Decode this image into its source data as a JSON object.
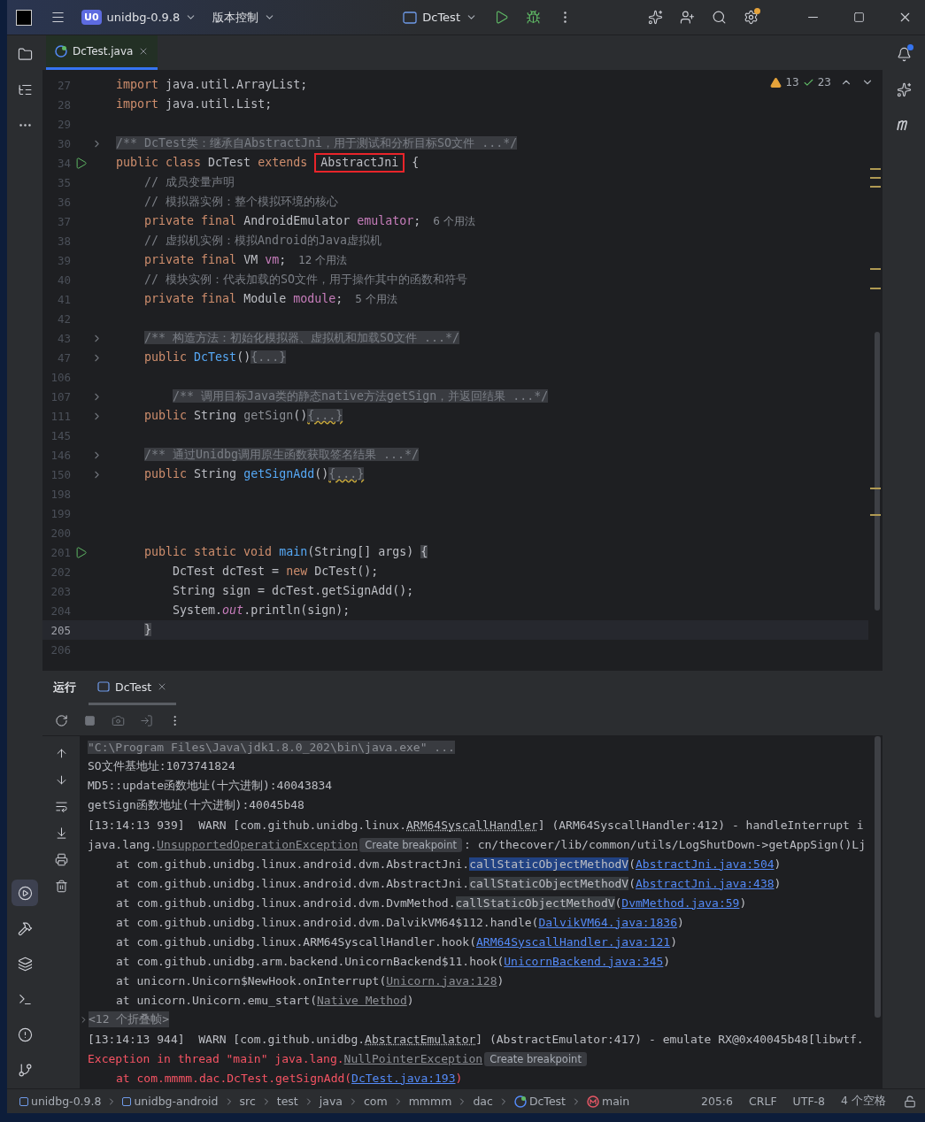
{
  "title_bar": {
    "project_badge": "U0",
    "project": "unidbg-0.9.8",
    "vcs": "版本控制",
    "run_config": "DcTest"
  },
  "editor_tabs": [
    {
      "label": "DcTest.java",
      "selected": true
    }
  ],
  "inspections": {
    "warnings": "13",
    "checks": "23"
  },
  "code_lines": [
    {
      "num": "27",
      "kind": "plain",
      "current": false,
      "tokens": [
        {
          "kind": "kw",
          "t": "import"
        },
        {
          "kind": "txt",
          "t": " java.util.ArrayList;"
        }
      ]
    },
    {
      "num": "28",
      "kind": "plain",
      "current": false,
      "tokens": [
        {
          "kind": "kw",
          "t": "import"
        },
        {
          "kind": "txt",
          "t": " java.util.List;"
        }
      ]
    },
    {
      "num": "29",
      "kind": "plain",
      "current": false
    },
    {
      "num": "30",
      "kind": "fold",
      "current": false,
      "tokens": [
        {
          "kind": "doc",
          "t": "/** DcTest类：继承自AbstractJni，用于测试和分析目标SO文件 ...*/"
        }
      ]
    },
    {
      "num": "34",
      "kind": "run",
      "current": false,
      "tokens": [
        {
          "kind": "kw",
          "t": "public class"
        },
        {
          "kind": "txt",
          "t": " DcTest "
        },
        {
          "kind": "kw",
          "t": "extends "
        },
        {
          "kind": "boxed",
          "t": "AbstractJni"
        },
        {
          "kind": "txt",
          "t": " {"
        }
      ]
    },
    {
      "num": "35",
      "kind": "plain",
      "current": false,
      "tokens": [
        {
          "kind": "cmt",
          "t": "    // 成员变量声明"
        }
      ]
    },
    {
      "num": "36",
      "kind": "plain",
      "current": false,
      "tokens": [
        {
          "kind": "cmt",
          "t": "    // 模拟器实例：整个模拟环境的核心"
        }
      ]
    },
    {
      "num": "37",
      "kind": "plain",
      "current": false,
      "hint": "6 个用法",
      "tokens": [
        {
          "kind": "kw",
          "t": "    private final"
        },
        {
          "kind": "txt",
          "t": " AndroidEmulator "
        },
        {
          "kind": "fld",
          "t": "emulator"
        },
        {
          "kind": "txt",
          "t": ";"
        }
      ]
    },
    {
      "num": "38",
      "kind": "plain",
      "current": false,
      "tokens": [
        {
          "kind": "cmt",
          "t": "    // 虚拟机实例：模拟Android的Java虚拟机"
        }
      ]
    },
    {
      "num": "39",
      "kind": "plain",
      "current": false,
      "hint": "12 个用法",
      "tokens": [
        {
          "kind": "kw",
          "t": "    private final"
        },
        {
          "kind": "txt",
          "t": " VM "
        },
        {
          "kind": "fld",
          "t": "vm"
        },
        {
          "kind": "txt",
          "t": ";"
        }
      ]
    },
    {
      "num": "40",
      "kind": "plain",
      "current": false,
      "tokens": [
        {
          "kind": "cmt",
          "t": "    // 模块实例：代表加载的SO文件，用于操作其中的函数和符号"
        }
      ]
    },
    {
      "num": "41",
      "kind": "plain",
      "current": false,
      "hint": "5 个用法",
      "tokens": [
        {
          "kind": "kw",
          "t": "    private final"
        },
        {
          "kind": "txt",
          "t": " Module "
        },
        {
          "kind": "fld",
          "t": "module"
        },
        {
          "kind": "txt",
          "t": ";"
        }
      ]
    },
    {
      "num": "42",
      "kind": "plain",
      "current": false
    },
    {
      "num": "43",
      "kind": "fold",
      "current": false,
      "tokens": [
        {
          "kind": "doc",
          "t": "    /** 构造方法：初始化模拟器、虚拟机和加载SO文件 ...*/"
        }
      ]
    },
    {
      "num": "47",
      "kind": "fold",
      "current": false,
      "tokens": [
        {
          "kind": "kw",
          "t": "    public "
        },
        {
          "kind": "fn",
          "t": "DcTest"
        },
        {
          "kind": "txt",
          "t": "()"
        },
        {
          "kind": "fold",
          "t": "{...}"
        }
      ]
    },
    {
      "num": "106",
      "kind": "plain",
      "current": false
    },
    {
      "num": "107",
      "kind": "fold",
      "current": false,
      "tokens": [
        {
          "kind": "doc",
          "t": "        /** 调用目标Java类的静态native方法getSign，并返回结果 ...*/"
        }
      ]
    },
    {
      "num": "111",
      "kind": "fold",
      "current": false,
      "tokens": [
        {
          "kind": "kw",
          "t": "    public"
        },
        {
          "kind": "txt",
          "t": " String "
        },
        {
          "kind": "dim",
          "t": "getSign"
        },
        {
          "kind": "txt",
          "t": "()"
        },
        {
          "kind": "foldw",
          "t": "{...}"
        }
      ]
    },
    {
      "num": "145",
      "kind": "plain",
      "current": false
    },
    {
      "num": "146",
      "kind": "fold",
      "current": false,
      "tokens": [
        {
          "kind": "doc",
          "t": "    /** 通过Unidbg调用原生函数获取签名结果 ...*/"
        }
      ]
    },
    {
      "num": "150",
      "kind": "fold",
      "current": false,
      "tokens": [
        {
          "kind": "kw",
          "t": "    public"
        },
        {
          "kind": "txt",
          "t": " String "
        },
        {
          "kind": "fn",
          "t": "getSignAdd"
        },
        {
          "kind": "txt",
          "t": "()"
        },
        {
          "kind": "foldw",
          "t": "{...}"
        }
      ]
    },
    {
      "num": "198",
      "kind": "plain",
      "current": false
    },
    {
      "num": "199",
      "kind": "plain",
      "current": false
    },
    {
      "num": "200",
      "kind": "plain",
      "current": false
    },
    {
      "num": "201",
      "kind": "run",
      "current": false,
      "tokens": [
        {
          "kind": "kw",
          "t": "    public static void "
        },
        {
          "kind": "fn",
          "t": "main"
        },
        {
          "kind": "txt",
          "t": "(String[] args) "
        },
        {
          "kind": "match",
          "t": "{"
        }
      ]
    },
    {
      "num": "202",
      "kind": "plain",
      "current": false,
      "tokens": [
        {
          "kind": "txt",
          "t": "        DcTest dcTest = "
        },
        {
          "kind": "kw",
          "t": "new"
        },
        {
          "kind": "txt",
          "t": " DcTest();"
        }
      ]
    },
    {
      "num": "203",
      "kind": "plain",
      "current": false,
      "tokens": [
        {
          "kind": "txt",
          "t": "        String sign = dcTest.getSignAdd();"
        }
      ]
    },
    {
      "num": "204",
      "kind": "plain",
      "current": false,
      "tokens": [
        {
          "kind": "txt",
          "t": "        System."
        },
        {
          "kind": "out",
          "t": "out"
        },
        {
          "kind": "txt",
          "t": ".println(sign);"
        }
      ]
    },
    {
      "num": "205",
      "kind": "plain",
      "current": true,
      "tokens": [
        {
          "kind": "match",
          "t": "    }"
        }
      ]
    },
    {
      "num": "206",
      "kind": "plain",
      "current": false
    }
  ],
  "run_panel": {
    "title": "运行",
    "tabs": [
      {
        "label": "DcTest",
        "selected": true
      }
    ]
  },
  "console_lines": [
    {
      "kind": "cmd",
      "tokens": [
        {
          "kind": "txt",
          "t": "\"C:\\Program Files\\Java\\jdk1.8.0_202\\bin\\java.exe\" ..."
        }
      ]
    },
    {
      "kind": "plain",
      "tokens": [
        {
          "kind": "txt",
          "t": "SO文件基地址:1073741824"
        }
      ]
    },
    {
      "kind": "plain",
      "tokens": [
        {
          "kind": "txt",
          "t": "MD5::update函数地址(十六进制):40043834"
        }
      ]
    },
    {
      "kind": "plain",
      "tokens": [
        {
          "kind": "txt",
          "t": "getSign函数地址(十六进制):40045b48"
        }
      ]
    },
    {
      "kind": "plain",
      "tokens": [
        {
          "kind": "txt",
          "t": "[13:14:13 939]  WARN [com.github.unidbg.linux."
        },
        {
          "kind": "dot",
          "t": "ARM64SyscallHandler"
        },
        {
          "kind": "txt",
          "t": "] (ARM64SyscallHandler:412) - handleInterrupt i"
        }
      ]
    },
    {
      "kind": "plain",
      "tokens": [
        {
          "kind": "txt",
          "t": "java.lang."
        },
        {
          "kind": "glink",
          "t": "UnsupportedOperationException"
        },
        {
          "kind": "bp",
          "t": "Create breakpoint"
        },
        {
          "kind": "txt",
          "t": ": cn/thecover/lib/common/utils/LogShutDown->getAppSign()Lj"
        }
      ]
    },
    {
      "kind": "frame",
      "tokens": [
        {
          "kind": "txt",
          "t": "at com.github.unidbg.linux.android.dvm.AbstractJni."
        },
        {
          "kind": "sel",
          "t": "callStaticObjectMethodV"
        },
        {
          "kind": "txt",
          "t": "("
        },
        {
          "kind": "link",
          "t": "AbstractJni.java:504"
        },
        {
          "kind": "txt",
          "t": ")"
        }
      ]
    },
    {
      "kind": "frame",
      "tokens": [
        {
          "kind": "txt",
          "t": "at com.github.unidbg.linux.android.dvm.AbstractJni."
        },
        {
          "kind": "hl",
          "t": "callStaticObjectMethodV"
        },
        {
          "kind": "txt",
          "t": "("
        },
        {
          "kind": "link",
          "t": "AbstractJni.java:438"
        },
        {
          "kind": "txt",
          "t": ")"
        }
      ]
    },
    {
      "kind": "frame",
      "tokens": [
        {
          "kind": "txt",
          "t": "at com.github.unidbg.linux.android.dvm.DvmMethod."
        },
        {
          "kind": "hl",
          "t": "callStaticObjectMethodV"
        },
        {
          "kind": "txt",
          "t": "("
        },
        {
          "kind": "link",
          "t": "DvmMethod.java:59"
        },
        {
          "kind": "txt",
          "t": ")"
        }
      ]
    },
    {
      "kind": "frame",
      "tokens": [
        {
          "kind": "txt",
          "t": "at com.github.unidbg.linux.android.dvm.DalvikVM64$112.handle("
        },
        {
          "kind": "link",
          "t": "DalvikVM64.java:1836"
        },
        {
          "kind": "txt",
          "t": ")"
        }
      ]
    },
    {
      "kind": "frame",
      "tokens": [
        {
          "kind": "txt",
          "t": "at com.github.unidbg.linux.ARM64SyscallHandler.hook("
        },
        {
          "kind": "link",
          "t": "ARM64SyscallHandler.java:121"
        },
        {
          "kind": "txt",
          "t": ")"
        }
      ]
    },
    {
      "kind": "frame",
      "tokens": [
        {
          "kind": "txt",
          "t": "at com.github.unidbg.arm.backend.UnicornBackend$11.hook("
        },
        {
          "kind": "link",
          "t": "UnicornBackend.java:345"
        },
        {
          "kind": "txt",
          "t": ")"
        }
      ]
    },
    {
      "kind": "frame",
      "tokens": [
        {
          "kind": "txt",
          "t": "at unicorn.Unicorn$NewHook.onInterrupt("
        },
        {
          "kind": "glink",
          "t": "Unicorn.java:128"
        },
        {
          "kind": "txt",
          "t": ")"
        }
      ]
    },
    {
      "kind": "frame",
      "tokens": [
        {
          "kind": "txt",
          "t": "at unicorn.Unicorn.emu_start("
        },
        {
          "kind": "glink",
          "t": "Native Method"
        },
        {
          "kind": "txt",
          "t": ")"
        }
      ]
    },
    {
      "kind": "folded",
      "tokens": [
        {
          "kind": "txt",
          "t": "<12 个折叠帧>"
        }
      ]
    },
    {
      "kind": "plain",
      "tokens": [
        {
          "kind": "txt",
          "t": "[13:14:13 944]  WARN [com.github.unidbg."
        },
        {
          "kind": "dot",
          "t": "AbstractEmulator"
        },
        {
          "kind": "txt",
          "t": "] (AbstractEmulator:417) - emulate RX@0x40045b48[libwtf."
        }
      ]
    },
    {
      "kind": "error",
      "tokens": [
        {
          "kind": "txt",
          "t": "Exception in thread \"main\" java.lang."
        },
        {
          "kind": "glink",
          "t": "NullPointerException"
        },
        {
          "kind": "bp",
          "t": "Create breakpoint"
        }
      ]
    },
    {
      "kind": "error_frame",
      "tokens": [
        {
          "kind": "txt",
          "t": "at com.mmmm.dac.DcTest.getSignAdd("
        },
        {
          "kind": "link",
          "t": "DcTest.java:193"
        },
        {
          "kind": "txt",
          "t": ")"
        }
      ]
    }
  ],
  "left_tools": {
    "top": [
      {
        "selected": false
      },
      {
        "selected": false
      }
    ],
    "bottom": [
      {
        "selected": true
      },
      {
        "selected": false
      },
      {
        "selected": false
      },
      {
        "selected": false
      },
      {
        "selected": false
      },
      {
        "selected": false
      }
    ]
  },
  "breadcrumbs": [
    {
      "label": "unidbg-0.9.8",
      "kind": "module"
    },
    {
      "label": "unidbg-android",
      "kind": "module"
    },
    {
      "label": "src",
      "kind": "folder"
    },
    {
      "label": "test",
      "kind": "folder"
    },
    {
      "label": "java",
      "kind": "folder"
    },
    {
      "label": "com",
      "kind": "folder"
    },
    {
      "label": "mmmm",
      "kind": "folder"
    },
    {
      "label": "dac",
      "kind": "folder"
    },
    {
      "label": "DcTest",
      "kind": "class"
    },
    {
      "label": "main",
      "kind": "method"
    }
  ],
  "status_items": [
    "205:6",
    "CRLF",
    "UTF-8",
    "4 个空格"
  ]
}
